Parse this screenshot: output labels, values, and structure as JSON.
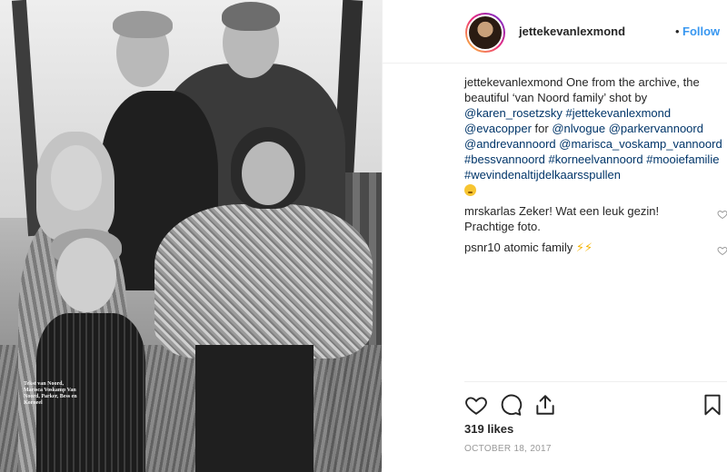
{
  "post": {
    "username": "jettekevanlexmond",
    "separator": "•",
    "follow_label": "Follow",
    "photo_caption_text": "Tekst van Noord, Marisca Voskamp Van Noord, Parker, Bess en Korneel",
    "caption": {
      "user": "jettekevanlexmond",
      "text_1": "One from the archive, the beautiful ‘van Noord family’ shot by",
      "tags": [
        "@karen_rosetzsky",
        "#jettekevanlexmond",
        "@evacopper",
        "for",
        "@nlvogue",
        "@parkervannoord",
        "@andrevannoord",
        "@marisca_voskamp_vannoord",
        "#bessvannoord",
        "#korneelvannoord",
        "#mooiefamilie",
        "#wevindenaltijdelkaarsspullen"
      ],
      "emoji": "worried-face-emoji"
    },
    "comments": [
      {
        "user": "mrskarlas",
        "text": "Zeker! Wat een leuk gezin! Prachtige foto."
      },
      {
        "user": "psnr10",
        "text": "atomic family",
        "emoji": "⚡⚡"
      }
    ],
    "likes": "319 likes",
    "date": "OCTOBER 18, 2017"
  },
  "icons": {
    "like": "heart-icon",
    "comment": "comment-icon",
    "share": "share-icon",
    "save": "bookmark-icon"
  },
  "colors": {
    "follow": "#3897f0",
    "link": "#003569",
    "date": "#999999"
  }
}
